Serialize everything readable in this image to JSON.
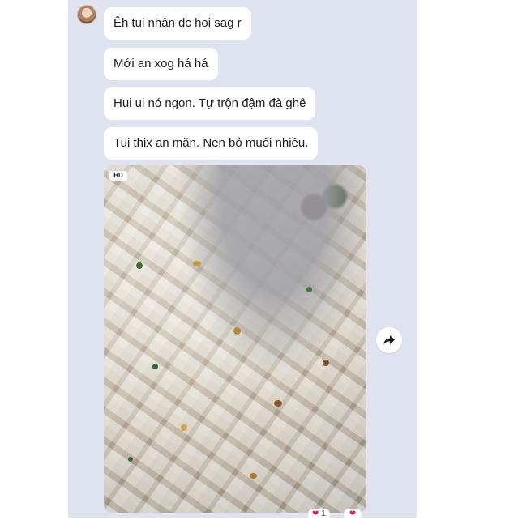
{
  "messages": [
    {
      "text": "Êh tui nhận  dc hoi sag r"
    },
    {
      "text": "Mới an xog há há"
    },
    {
      "text": "Hui ui nó ngon. Tự trộn đậm đà ghê"
    },
    {
      "text": "Tui thix an mặn. Nen bỏ muối nhiều."
    }
  ],
  "photo": {
    "badge": "HD",
    "description_icon": "food-photo"
  },
  "share": {
    "icon": "share-arrow-icon"
  },
  "reactions": {
    "first": {
      "icon": "heart-icon",
      "count": "1"
    },
    "second": {
      "icon": "heart-icon"
    }
  },
  "colors": {
    "panel_bg": "#dfe2ef",
    "bubble_bg": "#ffffff",
    "text": "#1c1c1e",
    "reaction": "#e0245e"
  }
}
